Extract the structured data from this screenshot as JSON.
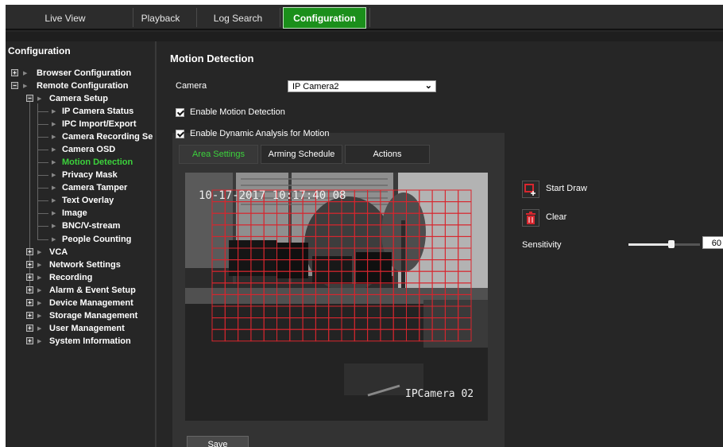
{
  "nav": {
    "tabs": [
      "Live View",
      "Playback",
      "Log Search",
      "Configuration"
    ],
    "active_tab": "Configuration"
  },
  "sidebar": {
    "title": "Configuration",
    "items": [
      {
        "label": "Browser Configuration"
      },
      {
        "label": "Remote Configuration"
      },
      {
        "label": "Camera Setup"
      },
      {
        "label": "IP Camera Status"
      },
      {
        "label": "IPC Import/Export"
      },
      {
        "label": "Camera Recording Se"
      },
      {
        "label": "Camera OSD"
      },
      {
        "label": "Motion Detection"
      },
      {
        "label": "Privacy Mask"
      },
      {
        "label": "Camera Tamper"
      },
      {
        "label": "Text Overlay"
      },
      {
        "label": "Image"
      },
      {
        "label": "BNC/V-stream"
      },
      {
        "label": "People Counting"
      },
      {
        "label": "VCA"
      },
      {
        "label": "Network Settings"
      },
      {
        "label": "Recording"
      },
      {
        "label": "Alarm & Event Setup"
      },
      {
        "label": "Device Management"
      },
      {
        "label": "Storage Management"
      },
      {
        "label": "User Management"
      },
      {
        "label": "System Information"
      }
    ],
    "active_item": "Motion Detection"
  },
  "main": {
    "title": "Motion Detection",
    "camera_label": "Camera",
    "camera_value": "IP Camera2",
    "enable_motion_label": "Enable Motion Detection",
    "enable_motion_checked": true,
    "enable_dynamic_label": "Enable Dynamic Analysis for Motion",
    "enable_dynamic_checked": true,
    "subtabs": [
      "Area Settings",
      "Arming Schedule",
      "Actions"
    ],
    "active_subtab": "Area Settings",
    "video": {
      "osd_time": "10-17-2017 10:17:40 08",
      "osd_name": "IPCamera 02"
    },
    "save_label": "Save",
    "start_draw_label": "Start Draw",
    "clear_label": "Clear",
    "sensitivity_label": "Sensitivity",
    "sensitivity_value": "60",
    "sensitivity_level": 0.6,
    "grid_color": "#d8262e",
    "accent_color": "#1b8f1b",
    "active_text_color": "#3cd23c"
  }
}
